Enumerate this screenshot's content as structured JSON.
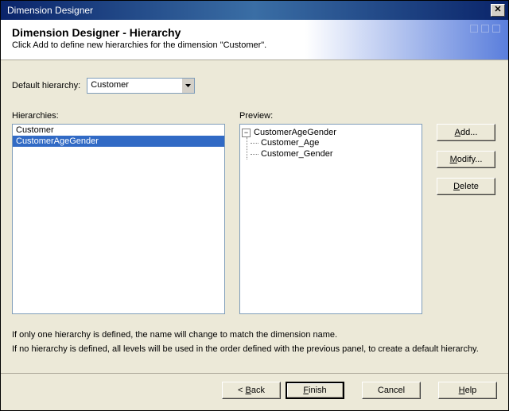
{
  "window": {
    "title": "Dimension Designer"
  },
  "header": {
    "title": "Dimension Designer - Hierarchy",
    "subtitle": "Click Add to define new hierarchies for the dimension \"Customer\"."
  },
  "default_hierarchy": {
    "label": "Default hierarchy:",
    "value": "Customer"
  },
  "hierarchies": {
    "label": "Hierarchies:",
    "items": [
      "Customer",
      "CustomerAgeGender"
    ],
    "selected_index": 1
  },
  "preview": {
    "label": "Preview:",
    "root": "CustomerAgeGender",
    "children": [
      "Customer_Age",
      "Customer_Gender"
    ]
  },
  "side_buttons": {
    "add": "Add...",
    "modify": "Modify...",
    "delete": "Delete"
  },
  "hints": {
    "line1": "If only one hierarchy is defined, the name will change to match the dimension name.",
    "line2": "If no hierarchy is defined, all levels will be used in the order defined with the previous panel, to create a default hierarchy."
  },
  "footer": {
    "back": "< Back",
    "finish": "Finish",
    "cancel": "Cancel",
    "help": "Help"
  }
}
